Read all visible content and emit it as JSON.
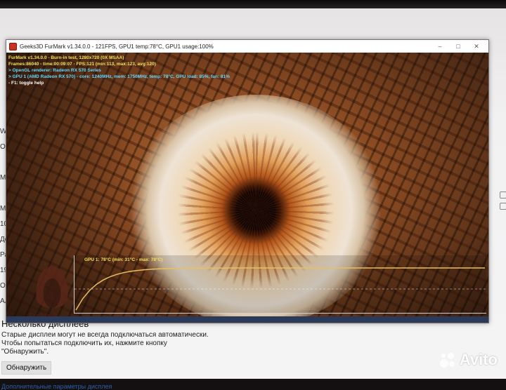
{
  "window": {
    "title": "Geeks3D FurMark v1.34.0.0 - 121FPS, GPU1 temp:78°C, GPU1 usage:100%",
    "buttons": {
      "minimize": "–",
      "maximize": "□",
      "close": "✕"
    }
  },
  "overlay": {
    "line1": "FurMark v1.34.0.0 - Burn-in test, 1280x720 (0X MSAA)",
    "line2": "Frames:86040 - time:00:09:07 - FPS:121 (min:113, max:123, avg:120)",
    "line3": "> OpenGL renderer: Radeon RX 570 Series",
    "line4": "> GPU 1 (AMD Radeon RX 570) - core: 1240MHz, mem: 1750MHz, temp: 78°C, GPU load: 85%, fan: 81%",
    "line5": "- F1: toggle help"
  },
  "graph": {
    "label_prefix": "GPU 1: 78°C",
    "label_range": "(min: 31°C - max: 78°C)",
    "min_temp": 31,
    "max_temp": 78,
    "current_temp": 78
  },
  "logo_text": "FurMark",
  "background_page": {
    "left_fragments": [
      "Wi",
      "OR",
      "",
      "Ма",
      "",
      "Мз",
      "100",
      "Дo",
      "Раз",
      "192",
      "Ори",
      "Ал"
    ],
    "section_title": "Несколько дисплеев",
    "description_line1": "Старые дисплеи могут не всегда подключаться автоматически.",
    "description_line2": "Чтобы попытаться подключить их, нажмите кнопку",
    "description_line3": "\"Обнаружить\".",
    "detect_button": "Обнаружить",
    "link": "Дополнительные параметры дисплея"
  },
  "watermark": "Avito",
  "colors": {
    "overlay_yellow": "#f2e35c",
    "overlay_cyan": "#63d9ff",
    "temp_curve": "#e8c060"
  }
}
